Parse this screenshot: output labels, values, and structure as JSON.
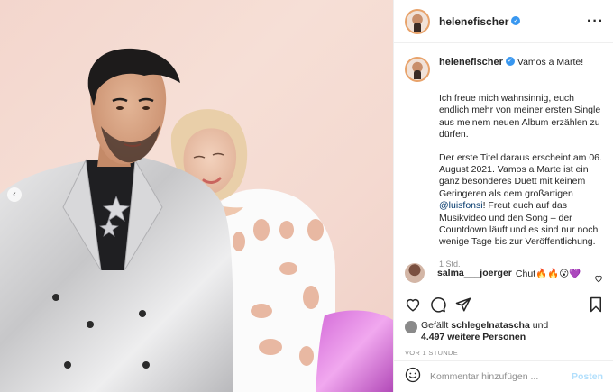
{
  "post": {
    "username": "helenefischer",
    "more_icon": "more-horizontal-icon",
    "caption_first": "Vamos a Marte!",
    "paragraph1": "Ich freue mich wahnsinnig, euch endlich mehr von meiner ersten Single aus meinem neuen Album erzählen zu dürfen.",
    "paragraph2_before": "Der erste Titel daraus erscheint am 06. August 2021. Vamos a Marte ist ein ganz besonderes Duett mit keinem Geringeren als dem großartigen ",
    "mention": "@luisfonsi",
    "paragraph2_after": "! Freut euch auf das Musikvideo und den Song – der Countdown läuft und es sind nur noch wenige Tage bis zur Veröffentlichung.",
    "caption_time": "1 Std."
  },
  "comment": {
    "username": "salma___joerger",
    "text": "Chut🔥🔥😮💜"
  },
  "likes": {
    "prefix": "Gefällt ",
    "user": "schlegelnatascha",
    "mid": " und",
    "count_text": "4.497 weitere Personen"
  },
  "time_label": "VOR 1 STUNDE",
  "comment_box": {
    "placeholder": "Kommentar hinzufügen ...",
    "post_label": "Posten"
  },
  "colors": {
    "verified": "#3897f0",
    "post_button": "#b2dffc",
    "mention": "#00376b"
  }
}
